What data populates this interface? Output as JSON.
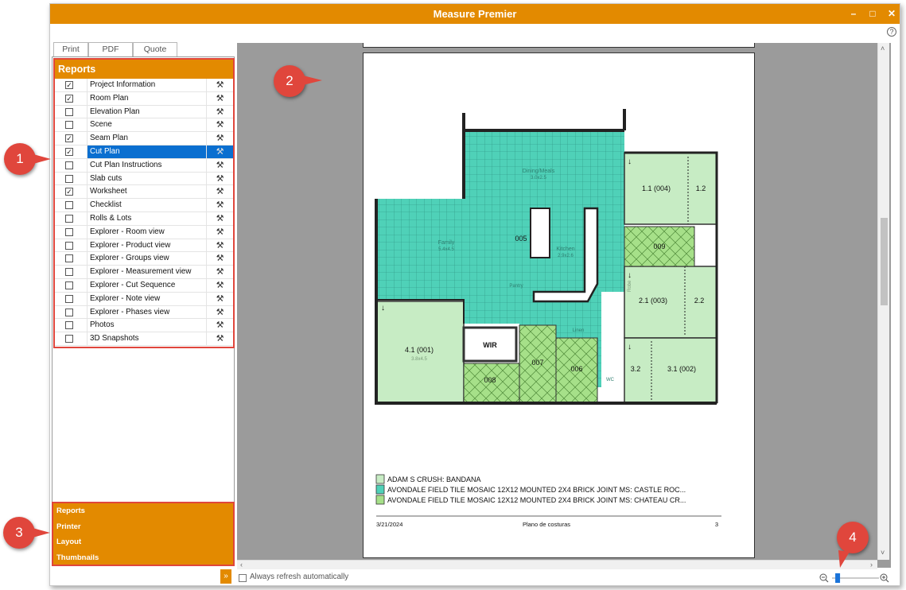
{
  "window": {
    "title": "Measure Premier",
    "help_glyph": "?"
  },
  "tabs": [
    {
      "label": "Print"
    },
    {
      "label": "PDF"
    },
    {
      "label": "Quote"
    }
  ],
  "reports": {
    "header": "Reports",
    "items": [
      {
        "label": "Project Information",
        "checked": true
      },
      {
        "label": "Room Plan",
        "checked": true
      },
      {
        "label": "Elevation Plan",
        "checked": false
      },
      {
        "label": "Scene",
        "checked": false
      },
      {
        "label": "Seam Plan",
        "checked": true
      },
      {
        "label": "Cut Plan",
        "checked": true,
        "selected": true
      },
      {
        "label": "Cut Plan Instructions",
        "checked": false
      },
      {
        "label": "Slab cuts",
        "checked": false
      },
      {
        "label": "Worksheet",
        "checked": true
      },
      {
        "label": "Checklist",
        "checked": false
      },
      {
        "label": "Rolls & Lots",
        "checked": false
      },
      {
        "label": "Explorer - Room view",
        "checked": false
      },
      {
        "label": "Explorer - Product view",
        "checked": false
      },
      {
        "label": "Explorer - Groups view",
        "checked": false
      },
      {
        "label": "Explorer - Measurement view",
        "checked": false
      },
      {
        "label": "Explorer - Cut Sequence",
        "checked": false
      },
      {
        "label": "Explorer - Note view",
        "checked": false
      },
      {
        "label": "Explorer - Phases view",
        "checked": false
      },
      {
        "label": "Photos",
        "checked": false
      },
      {
        "label": "3D Snapshots",
        "checked": false
      }
    ]
  },
  "bottom_nav": [
    {
      "label": "Reports"
    },
    {
      "label": "Printer"
    },
    {
      "label": "Layout"
    },
    {
      "label": "Thumbnails"
    }
  ],
  "collapse_glyph": "»",
  "status": {
    "auto_refresh_label": "Always refresh automatically"
  },
  "plan": {
    "rooms": [
      {
        "label": "Dining/Meals",
        "sub": "3.0x2.5"
      },
      {
        "label": "Family",
        "sub": "5.4x4.5"
      },
      {
        "label": "Kitchen",
        "sub": "2.9x2.6"
      },
      {
        "label": "Pantry"
      },
      {
        "label": "Linen"
      },
      {
        "label": "WC"
      }
    ],
    "area_labels": [
      {
        "text": "005"
      },
      {
        "text": "009"
      },
      {
        "text": "007"
      },
      {
        "text": "006"
      },
      {
        "text": "008"
      },
      {
        "text": "WIR"
      },
      {
        "text": "1.1 (004)"
      },
      {
        "text": "1.2"
      },
      {
        "text": "2.1 (003)"
      },
      {
        "text": "2.2"
      },
      {
        "text": "3.1 (002)"
      },
      {
        "text": "3.2"
      },
      {
        "text": "4.1 (001)"
      },
      {
        "text": "3.8x4.5"
      },
      {
        "text": "Robe"
      }
    ],
    "legend": [
      {
        "text": "ADAM S CRUSH: BANDANA",
        "color": "#c7ecc4"
      },
      {
        "text": "AVONDALE FIELD TILE MOSAIC 12X12 MOUNTED 2X4 BRICK JOINT MS: CASTLE ROC...",
        "color": "#4fd1b8"
      },
      {
        "text": "AVONDALE FIELD TILE MOSAIC 12X12 MOUNTED 2X4 BRICK JOINT MS: CHATEAU CR...",
        "color": "#a6e089"
      }
    ],
    "footer": {
      "date": "3/21/2024",
      "title": "Plano de costuras",
      "page": "3"
    }
  },
  "callouts": [
    {
      "n": "1"
    },
    {
      "n": "2"
    },
    {
      "n": "3"
    },
    {
      "n": "4"
    }
  ],
  "colors": {
    "accent": "#e38a00",
    "callout": "#e0463c",
    "selection": "#0a6fd0",
    "tile_teal": "#4fd1b8",
    "tile_green": "#a6e089",
    "carpet": "#c7ecc4"
  },
  "zoom": {
    "level": 0.12
  }
}
